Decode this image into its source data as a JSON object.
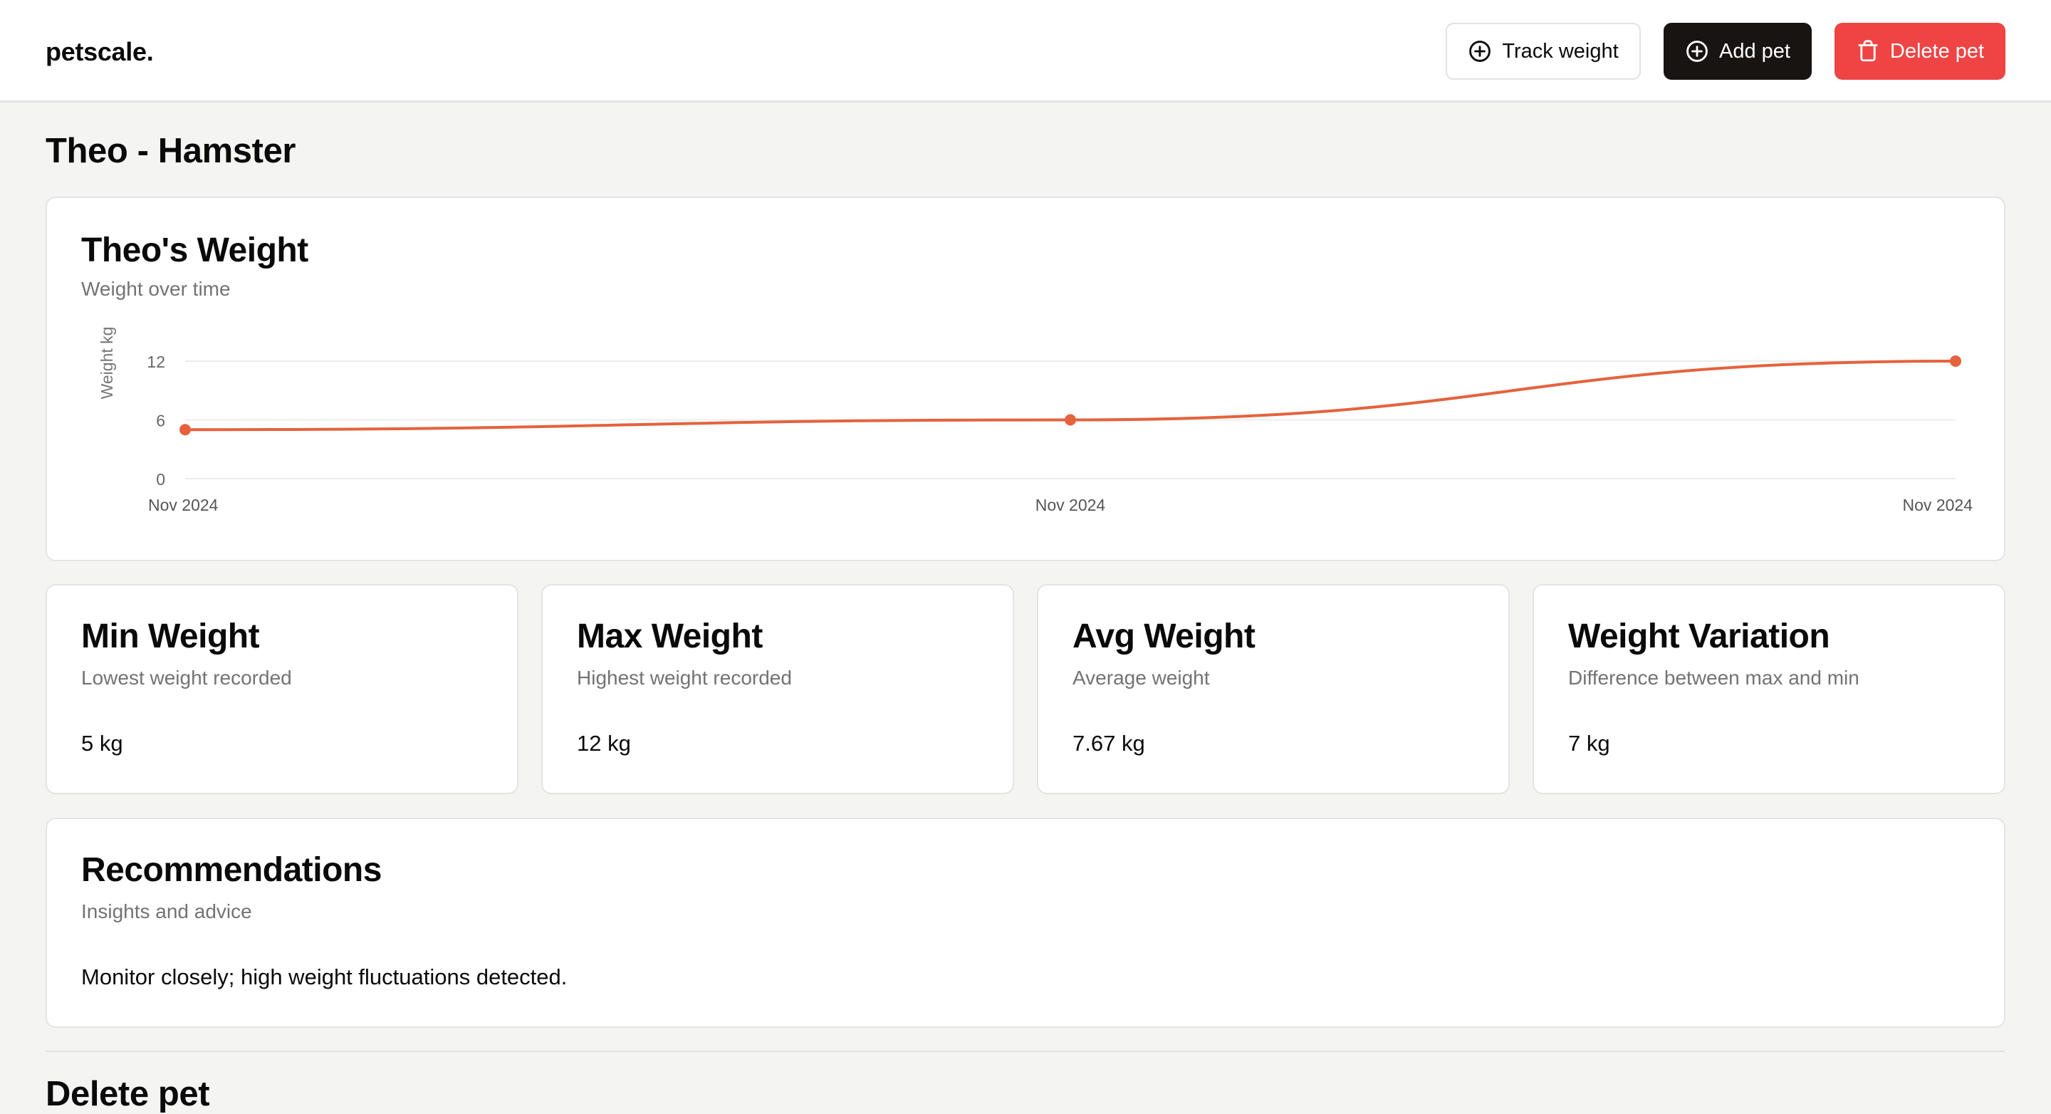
{
  "header": {
    "brand": "petscale.",
    "track_label": "Track weight",
    "add_label": "Add pet",
    "delete_label": "Delete pet"
  },
  "page": {
    "title": "Theo - Hamster"
  },
  "weight_card": {
    "title": "Theo's Weight",
    "subtitle": "Weight over time"
  },
  "chart_data": {
    "type": "line",
    "title": "Theo's Weight",
    "subtitle": "Weight over time",
    "xlabel": "",
    "ylabel": "Weight kg",
    "x_tick_labels": [
      "Nov 2024",
      "Nov 2024",
      "Nov 2024"
    ],
    "y_ticks": [
      0,
      6,
      12
    ],
    "ylim": [
      0,
      12
    ],
    "grid": "horizontal",
    "series": [
      {
        "values": [
          5,
          6,
          12
        ]
      }
    ],
    "line_color": "#e5623d"
  },
  "stats": [
    {
      "title": "Min Weight",
      "subtitle": "Lowest weight recorded",
      "value": "5 kg"
    },
    {
      "title": "Max Weight",
      "subtitle": "Highest weight recorded",
      "value": "12 kg"
    },
    {
      "title": "Avg Weight",
      "subtitle": "Average weight",
      "value": "7.67 kg"
    },
    {
      "title": "Weight Variation",
      "subtitle": "Difference between max and min",
      "value": "7 kg"
    }
  ],
  "recommendations": {
    "title": "Recommendations",
    "subtitle": "Insights and advice",
    "text": "Monitor closely; high weight fluctuations detected."
  },
  "next_section": {
    "title": "Delete pet"
  },
  "colors": {
    "accent": "#e5623d",
    "primary_button": "#171412",
    "danger": "#ef4444",
    "background": "#f4f4f3"
  },
  "icons": {
    "track": "plus-circle-icon",
    "add": "plus-circle-icon",
    "delete": "trash-icon"
  }
}
